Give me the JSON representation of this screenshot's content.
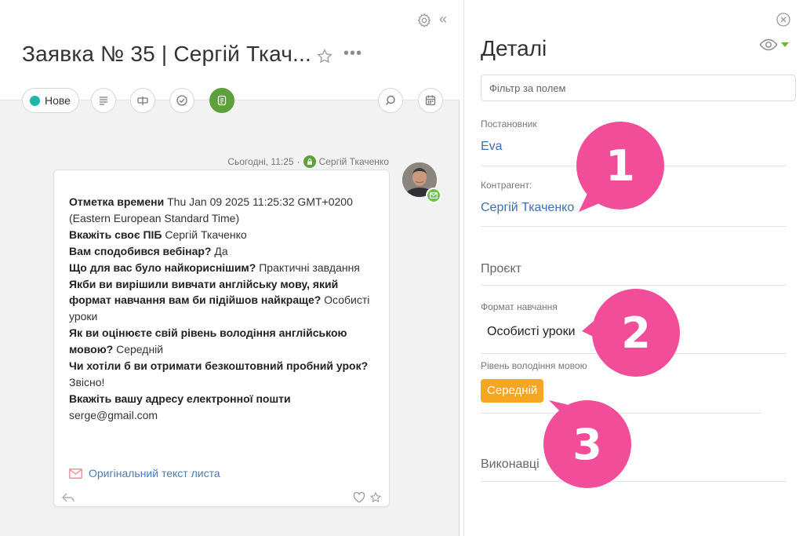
{
  "header": {
    "title": "Заявка № 35 | Сергій Ткач...",
    "status_label": "Нове"
  },
  "message": {
    "timestamp": "Сьогодні, 11:25",
    "sender": "Сергій Ткаченко",
    "lines": [
      {
        "label": "Отметка времени",
        "value": " Thu Jan 09 2025 11:25:32 GMT+0200 (Eastern European Standard Time)"
      },
      {
        "label": "Вкажіть своє ПІБ",
        "value": " Сергій Ткаченко"
      },
      {
        "label": "Вам сподобився вебінар?",
        "value": " Да"
      },
      {
        "label": "Що для вас було найкориснішим?",
        "value": " Практичні завдання"
      },
      {
        "label": "Якби ви вирішили вивчати англійську мову, який формат навчання вам би підійшов найкраще?",
        "value": " Особисті уроки"
      },
      {
        "label": "Як ви оцінюєте свій рівень володіння англійською мовою?",
        "value": " Середній"
      },
      {
        "label": "Чи хотіли б ви отримати безкоштовний пробний урок?",
        "value": " Звісно!"
      },
      {
        "label": "Вкажіть вашу адресу електронної пошти",
        "value": " serge@gmail.com"
      }
    ],
    "original_link": "Оригінальний текст листа"
  },
  "details": {
    "title": "Деталі",
    "filter_placeholder": "Фільтр за полем",
    "author_label": "Постановник",
    "author_value": "Eva",
    "contractor_label": "Контрагент:",
    "contractor_value": "Сергій Ткаченко",
    "project_section": "Проєкт",
    "format_label": "Формат навчання",
    "format_value": "Особисті уроки",
    "level_label": "Рівень володіння мовою",
    "level_value": "Середній",
    "executors_section": "Виконавці"
  },
  "annotations": {
    "one": "1",
    "two": "2",
    "three": "3"
  },
  "colors": {
    "status": "#1fb5a8",
    "accent_green": "#5ea03b",
    "link": "#3f6fb0",
    "level_chip": "#f6a623",
    "annotation": "#f24d98"
  }
}
